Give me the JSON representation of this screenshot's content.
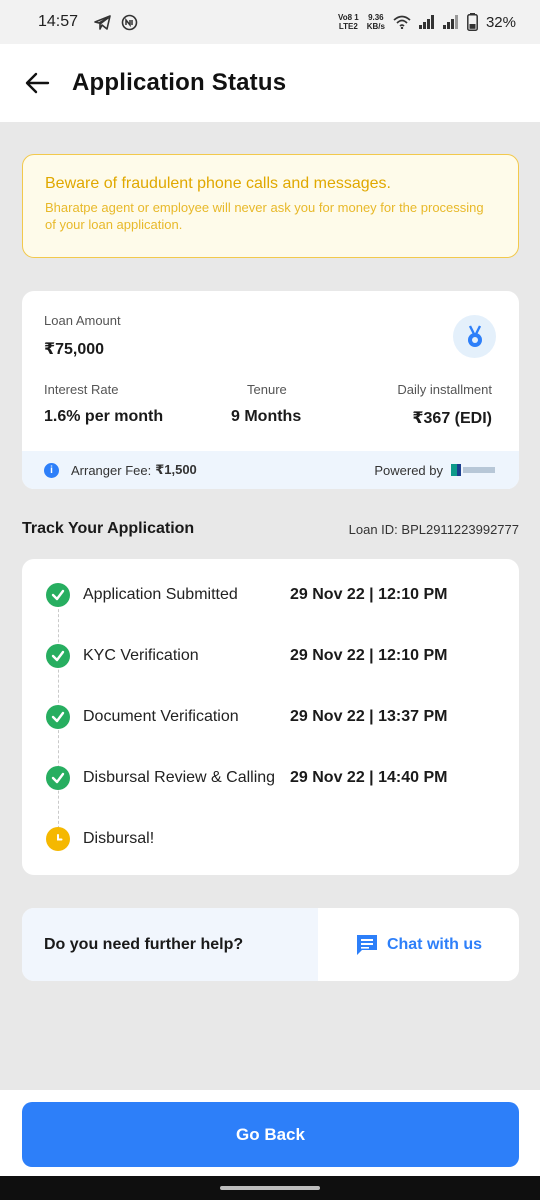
{
  "status_bar": {
    "time": "14:57",
    "network_label_1": "Vo8 1",
    "network_label_2": "LTE2",
    "speed_value": "9.36",
    "speed_unit": "KB/s",
    "battery": "32%"
  },
  "header": {
    "title": "Application Status"
  },
  "warning": {
    "title": "Beware of fraudulent phone calls and messages.",
    "body": "Bharatpe agent or employee will never ask you for money for the processing of your loan application."
  },
  "loan": {
    "amount_label": "Loan Amount",
    "amount_value": "₹75,000",
    "interest_label": "Interest Rate",
    "interest_value": "1.6% per month",
    "tenure_label": "Tenure",
    "tenure_value": "9 Months",
    "installment_label": "Daily installment",
    "installment_value": "₹367 (EDI)",
    "fee_label": "Arranger Fee:",
    "fee_value": "₹1,500",
    "powered_by": "Powered by"
  },
  "track": {
    "title": "Track Your Application",
    "loan_id": "Loan ID: BPL2911223992777",
    "steps": [
      {
        "label": "Application Submitted",
        "time": "29 Nov 22 | 12:10 PM",
        "status": "done"
      },
      {
        "label": "KYC Verification",
        "time": "29 Nov 22 | 12:10 PM",
        "status": "done"
      },
      {
        "label": "Document Verification",
        "time": "29 Nov 22 | 13:37 PM",
        "status": "done"
      },
      {
        "label": "Disbursal Review & Calling",
        "time": "29 Nov 22 | 14:40 PM",
        "status": "done"
      },
      {
        "label": "Disbursal!",
        "time": "",
        "status": "pending"
      }
    ]
  },
  "help": {
    "question": "Do you need further help?",
    "chat_label": "Chat with us"
  },
  "footer": {
    "go_back_label": "Go Back"
  },
  "colors": {
    "primary": "#2d7ff9",
    "success": "#27ae60",
    "pending": "#f5b800",
    "warning_text": "#e0a800"
  }
}
